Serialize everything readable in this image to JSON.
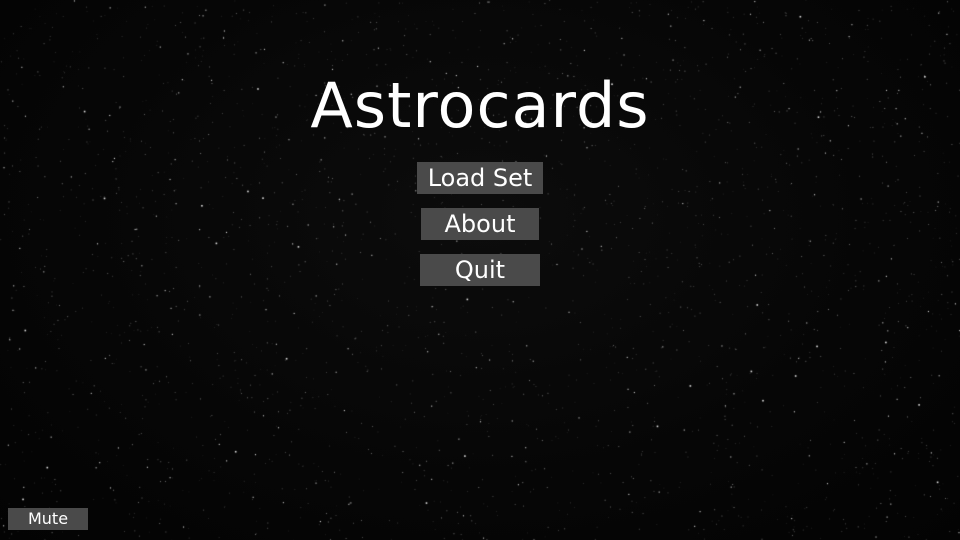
{
  "game": {
    "title": "Astrocards"
  },
  "menu": {
    "load_set_label": "Load Set",
    "about_label": "About",
    "quit_label": "Quit"
  },
  "controls": {
    "mute_label": "Mute"
  },
  "colors": {
    "background": "#050505",
    "button_bg": "#4a4a4a",
    "text": "#ffffff",
    "stars": "#ffffff"
  }
}
